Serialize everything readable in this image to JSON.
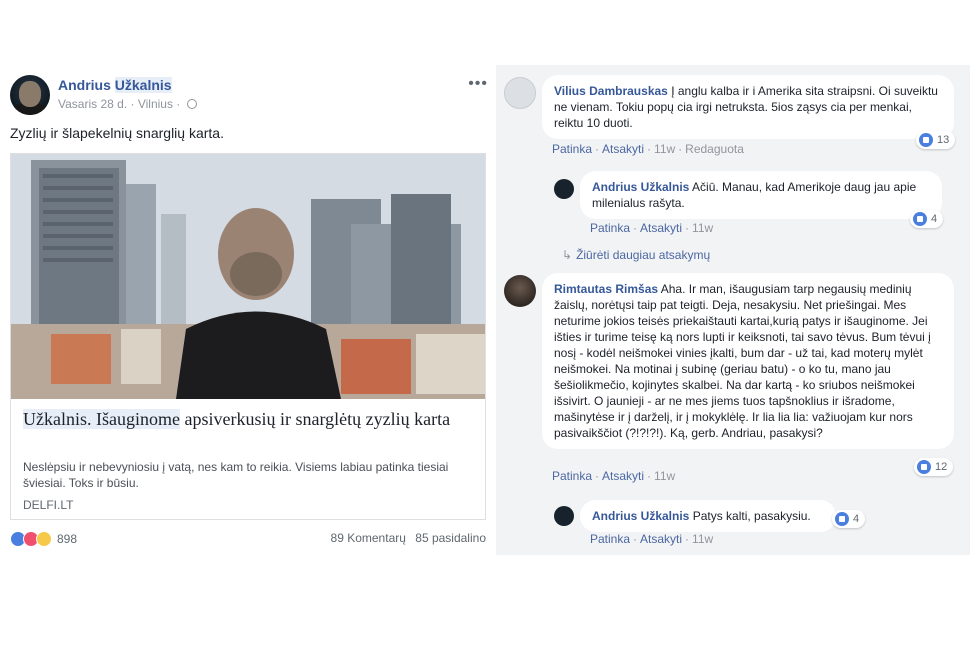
{
  "post": {
    "author_first": "Andrius",
    "author_last": "Užkalnis",
    "date": "Vasaris 28 d.",
    "location": "Vilnius",
    "more": "•••",
    "text": "Zyzlių ir šlapekelnių snarglių karta.",
    "link": {
      "title_part1": "Užkalnis. Išauginome",
      "title_part2": " apsiverkusių ir snarglėtų zyzlių karta",
      "description": "Neslėpsiu ir nebevyniosiu į vatą, nes kam to reikia. Visiems labiau patinka tiesiai šviesiai. Toks ir būsiu.",
      "domain": "DELFI.LT"
    },
    "reaction_count": "898",
    "comments": "89 Komentarų",
    "shares": "85 pasidalino"
  },
  "comments": [
    {
      "name": "Vilius Dambrauskas",
      "text": "Į anglu kalba ir i Amerika sita straipsni. Oi suveiktu ne vienam. Tokiu popų cia irgi netruksta. 5ios ząsys cia per menkai, reiktu 10 duoti.",
      "like": "Patinka",
      "reply": "Atsakyti",
      "time": "11w",
      "edited": "Redaguota",
      "likes": "13"
    },
    {
      "name": "Andrius Užkalnis",
      "text": "Ačiū. Manau, kad Amerikoje daug jau apie milenialus rašyta.",
      "like": "Patinka",
      "reply": "Atsakyti",
      "time": "11w",
      "likes": "4"
    },
    {
      "more_replies": "Žiūrėti daugiau atsakymų"
    },
    {
      "name": "Rimtautas Rimšas",
      "text": "Aha. Ir man, išaugusiam tarp negausių medinių žaislų, norėtųsi taip pat teigti. Deja, nesakysiu. Net priešingai. Mes neturime jokios teisės priekaištauti kartai,kurią patys ir išauginome. Jei išties ir turime teisę ką nors lupti ir keiksnoti, tai savo tėvus. Bum tėvui į nosį - kodėl neišmokei vinies įkalti, bum dar - už tai, kad moterų mylėt neišmokei. Na motinai į subinę (geriau batu) - o ko tu, mano jau šešiolikmečio, kojinytes skalbei. Na dar kartą - ko sriubos neišmokei išsivirt. O jaunieji - ar ne mes jiems tuos tapšnoklius ir išradome, mašinytėse ir į darželį, ir į mokyklėlę. Ir lia lia lia: važiuojam kur nors pasivaikščiot (?!?!?!). Ką, gerb. Andriau, pasakysi?",
      "like": "Patinka",
      "reply": "Atsakyti",
      "time": "11w",
      "likes": "12"
    },
    {
      "name": "Andrius Užkalnis",
      "text": "Patys kalti, pasakysiu.",
      "like": "Patinka",
      "reply": "Atsakyti",
      "time": "11w",
      "likes": "4"
    }
  ]
}
